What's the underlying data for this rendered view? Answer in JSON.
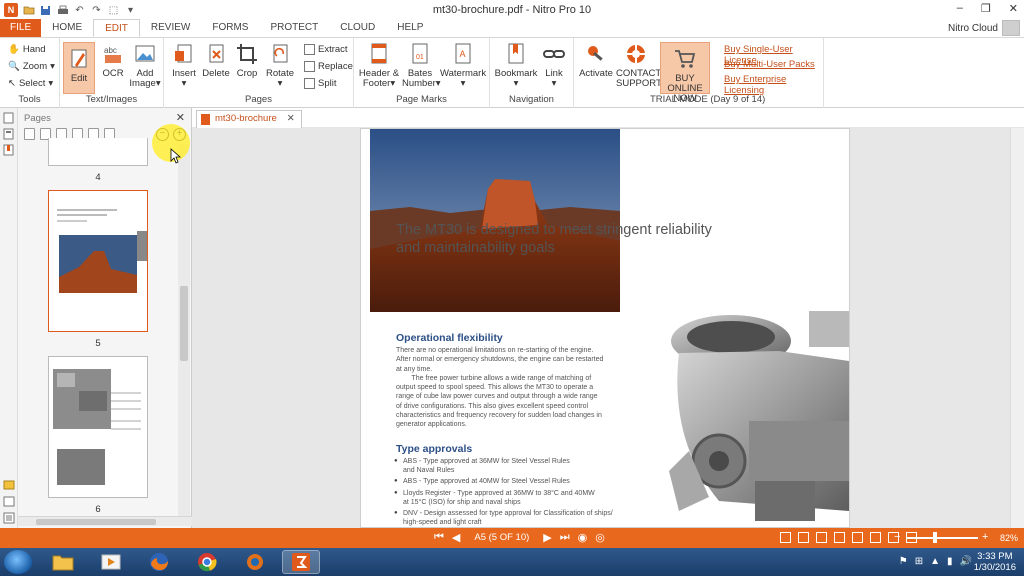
{
  "window": {
    "title": "mt30-brochure.pdf - Nitro Pro 10",
    "minimize": "–",
    "maximize": "❐",
    "close": "✕"
  },
  "tabs": [
    "FILE",
    "HOME",
    "EDIT",
    "REVIEW",
    "FORMS",
    "PROTECT",
    "CLOUD",
    "HELP"
  ],
  "active_tab": "EDIT",
  "cloud_user": "Nitro Cloud",
  "ribbon": {
    "tools": {
      "label": "Tools",
      "hand": "Hand",
      "zoom": "Zoom",
      "select": "Select"
    },
    "text_images": {
      "label": "Text/Images",
      "edit": "Edit",
      "ocr": "OCR",
      "add_image_1": "Add",
      "add_image_2": "Image"
    },
    "pages": {
      "label": "Pages",
      "insert": "Insert",
      "delete": "Delete",
      "crop": "Crop",
      "rotate": "Rotate",
      "extract": "Extract",
      "replace": "Replace",
      "split": "Split"
    },
    "page_marks": {
      "label": "Page Marks",
      "header_1": "Header &",
      "header_2": "Footer",
      "bates_1": "Bates",
      "bates_2": "Number",
      "watermark": "Watermark"
    },
    "navigation": {
      "label": "Navigation",
      "bookmark": "Bookmark",
      "link": "Link"
    },
    "trial": {
      "label": "TRIAL MODE (Day 9 of 14)",
      "activate": "Activate",
      "contact_1": "CONTACT",
      "contact_2": "SUPPORT",
      "buy_1": "BUY ONLINE",
      "buy_2": "NOW"
    },
    "links": [
      "Buy Single-User License",
      "Buy Multi-User Packs",
      "Buy Enterprise Licensing"
    ]
  },
  "pages_panel": {
    "title": "Pages",
    "close": "✕",
    "thumbs": [
      "4",
      "5",
      "6"
    ]
  },
  "document": {
    "tab_label": "mt30-brochure",
    "tab_close": "✕",
    "headline_1": "The MT30 is designed to meet stringent reliability",
    "headline_2": "and maintainability goals",
    "op_flex_title": "Operational flexibility",
    "op_flex_lines": [
      "There are no operational limitations on re-starting of the engine.",
      "After normal or emergency shutdowns, the engine can be restarted",
      "at any time.",
      "        The free power turbine allows a wide range of matching of",
      "output speed to spool speed. This allows the MT30 to operate a",
      "range of cube law power curves and output through a wide range",
      "of drive configurations. This also gives excellent speed control",
      "characteristics and frequency recovery for sudden load changes in",
      "generator applications."
    ],
    "type_approvals_title": "Type approvals",
    "approvals": [
      [
        "ABS - Type approved at 36MW for Steel Vessel Rules",
        "and Naval Rules"
      ],
      [
        "ABS - Type approved at 40MW for Steel Vessel Rules"
      ],
      [
        "Lloyds Register - Type approved at 36MW to 38°C and 40MW",
        "at 15°C (ISO) for ship and naval ships"
      ],
      [
        "DNV - Design assessed for type approval for Classification of ships/",
        "high-speed and light craft"
      ]
    ]
  },
  "statusbar": {
    "page_indicator": "A5 (5 OF 10)",
    "zoom": "82%",
    "zoom_value": 0.4
  },
  "taskbar": {
    "time": "3:33 PM",
    "date": "1/30/2016"
  },
  "colors": {
    "brand": "#e05a1c",
    "status": "#e8691e",
    "link": "#c5501a",
    "heading": "#2c4f86"
  }
}
